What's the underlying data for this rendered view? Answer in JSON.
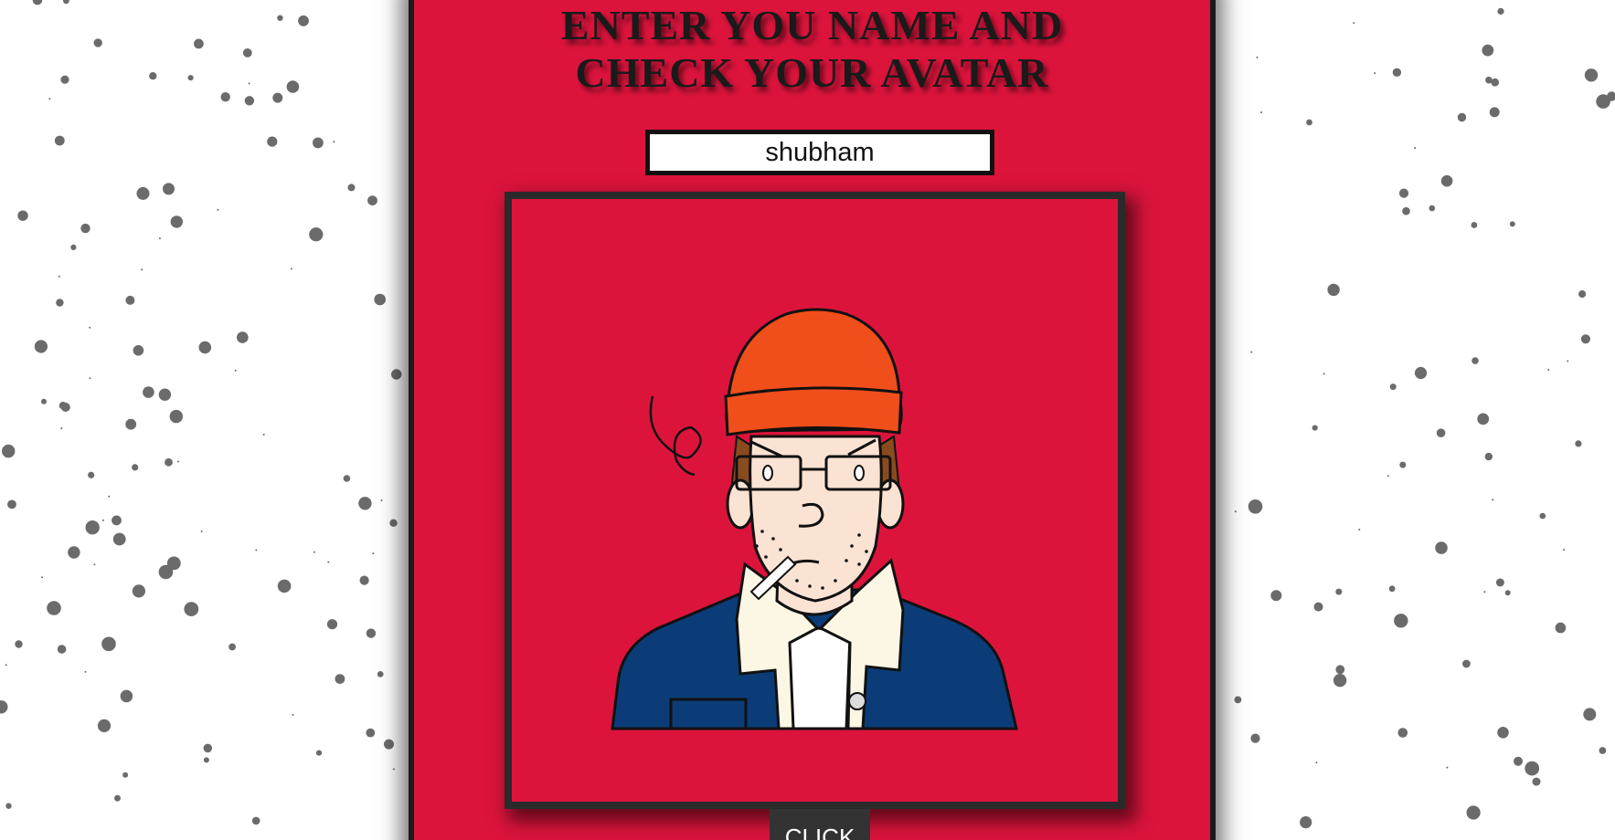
{
  "page": {
    "title_line1": "ENTER YOU NAME AND",
    "title_line2": "CHECK YOUR AVATAR"
  },
  "name_input": {
    "value": "shubham"
  },
  "avatar": {
    "icon": "avatar-illustration"
  },
  "button": {
    "label": "CLICK"
  },
  "colors": {
    "card": "#dc143c",
    "hat": "#f04e1a",
    "jacket": "#0b3c78",
    "skin": "#fbe3d4",
    "dots": "#6b6b6b"
  }
}
